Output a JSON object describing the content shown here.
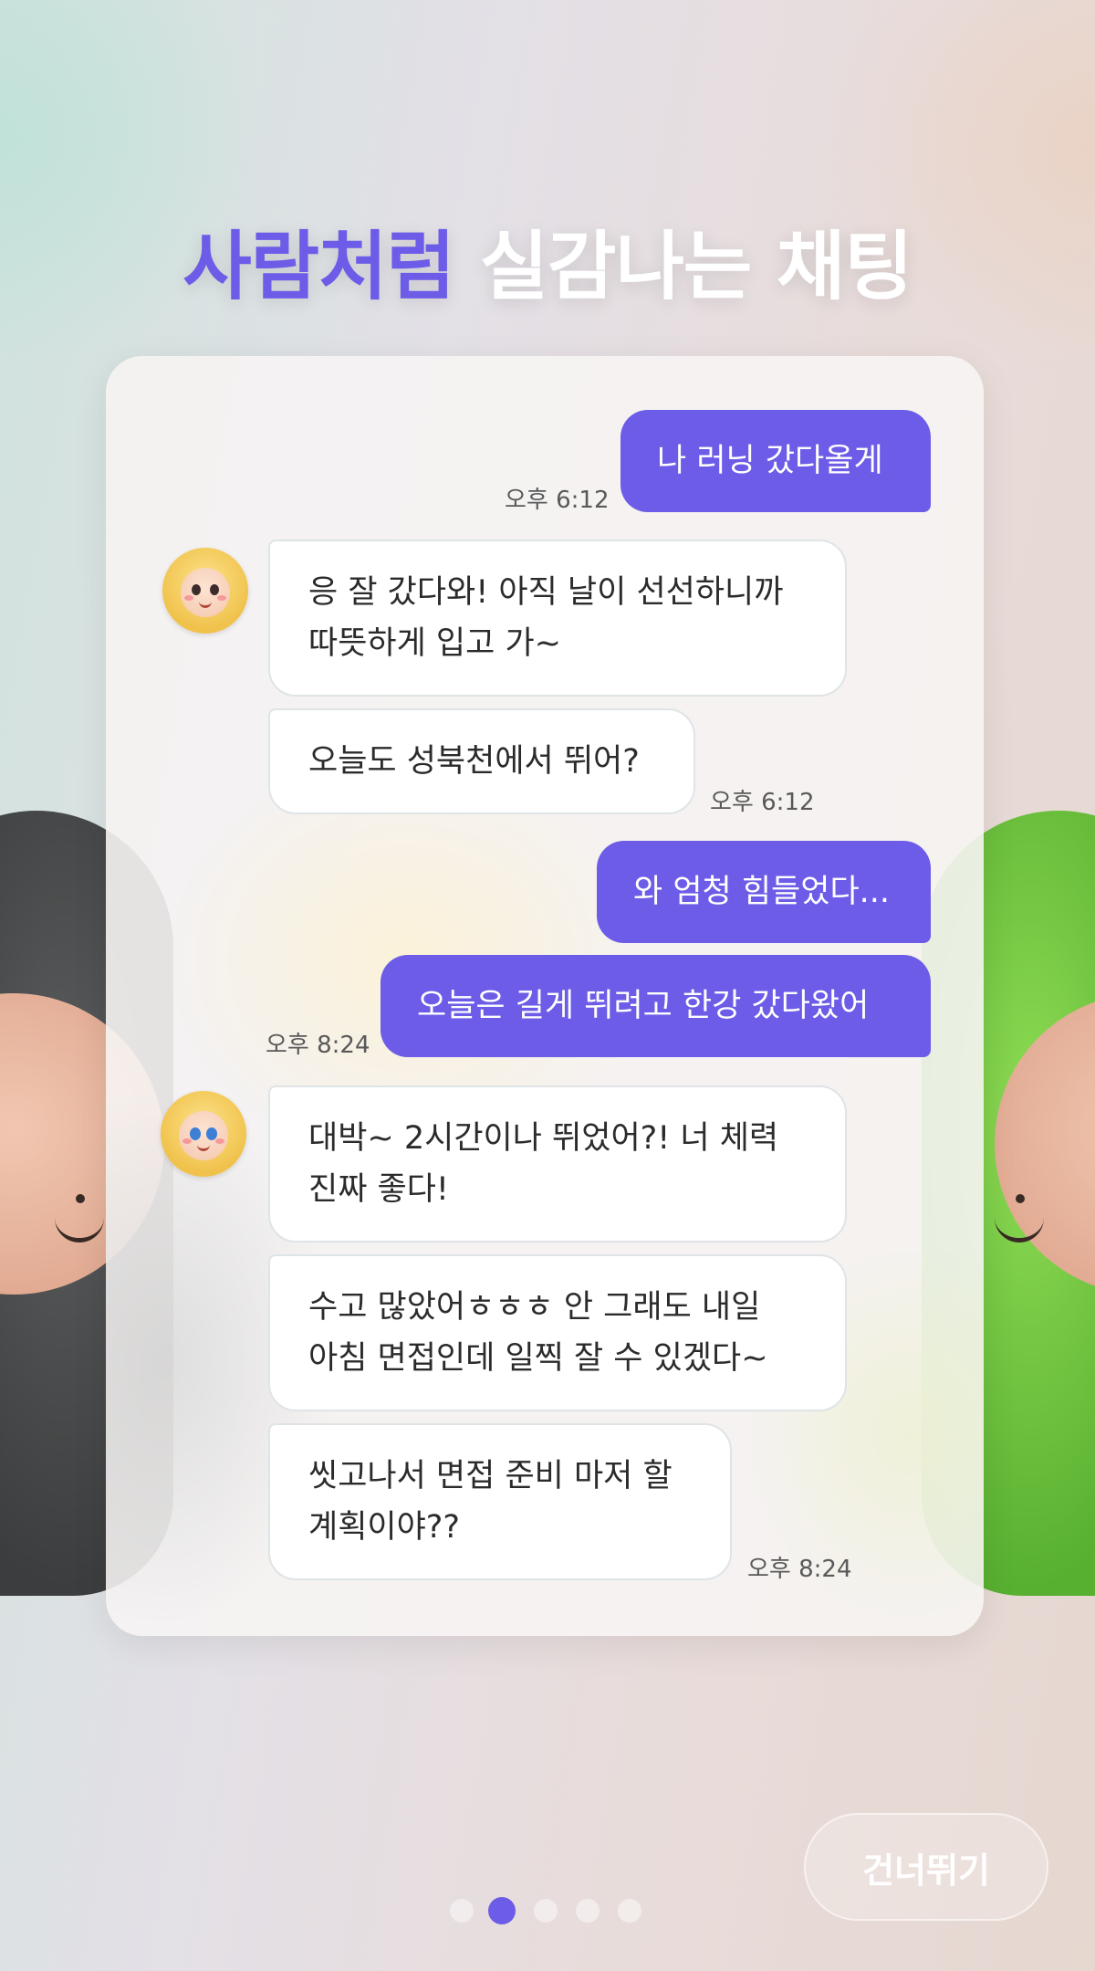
{
  "header": {
    "title_accent": "사람처럼",
    "title_rest": "실감나는 채팅"
  },
  "chat": {
    "messages": [
      {
        "sender": "user",
        "text": "나 러닝 갔다올게",
        "time": "오후 6:12"
      },
      {
        "sender": "bot",
        "text": "응 잘 갔다와! 아직 날이 선선하니까\n따뜻하게 입고 가~"
      },
      {
        "sender": "bot",
        "text": "오늘도 성북천에서 뛰어?",
        "time": "오후 6:12"
      },
      {
        "sender": "user",
        "text": "와 엄청 힘들었다..."
      },
      {
        "sender": "user",
        "text": "오늘은 길게 뛰려고 한강 갔다왔어",
        "time": "오후 8:24"
      },
      {
        "sender": "bot",
        "text": "대박~ 2시간이나 뛰었어?! 너 체력\n진짜 좋다!"
      },
      {
        "sender": "bot",
        "text": "수고 많았어ㅎㅎㅎ 안 그래도 내일\n아침 면접인데 일찍 잘 수 있겠다~"
      },
      {
        "sender": "bot",
        "text": "씻고나서 면접 준비 마저 할\n계획이야??",
        "time": "오후 8:24"
      }
    ]
  },
  "pagination": {
    "count": 5,
    "active_index": 1
  },
  "skip_button": {
    "label": "건너뛰기"
  },
  "colors": {
    "accent": "#6c5ce7",
    "user_bubble_text": "#ffffff",
    "bot_bubble_bg": "#ffffff",
    "title_rest": "#ffffff"
  },
  "icons": {
    "avatar_1": "bot-avatar-smiling-icon",
    "avatar_2": "bot-avatar-blue-eyes-icon"
  }
}
